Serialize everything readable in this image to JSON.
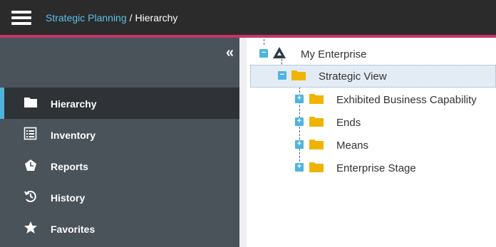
{
  "header": {
    "menu_icon": "hamburger-icon",
    "breadcrumb": {
      "parent": "Strategic Planning",
      "separator": "/",
      "current": "Hierarchy"
    },
    "colors": {
      "bar": "#2b2b2b",
      "accent": "#c8336b",
      "link": "#5bc0eb"
    }
  },
  "sidebar": {
    "collapse_icon": "double-chevron-left-icon",
    "items": [
      {
        "label": "Hierarchy",
        "icon": "folder-icon",
        "active": true
      },
      {
        "label": "Inventory",
        "icon": "list-icon",
        "active": false
      },
      {
        "label": "Reports",
        "icon": "pie-chart-icon",
        "active": false
      },
      {
        "label": "History",
        "icon": "history-icon",
        "active": false
      },
      {
        "label": "Favorites",
        "icon": "star-icon",
        "active": false
      }
    ],
    "colors": {
      "background": "#4a525a",
      "active_background": "#2f3236",
      "active_marker": "#4fb3e0"
    }
  },
  "tree": {
    "root": {
      "label": "My Enterprise",
      "icon": "enterprise-icon",
      "expanded": true
    },
    "selected": {
      "label": "Strategic View",
      "icon": "folder-icon",
      "expanded": true
    },
    "children": [
      {
        "label": "Exhibited Business Capability",
        "icon": "folder-icon",
        "expanded": false
      },
      {
        "label": "Ends",
        "icon": "folder-icon",
        "expanded": false
      },
      {
        "label": "Means",
        "icon": "folder-icon",
        "expanded": false
      },
      {
        "label": "Enterprise Stage",
        "icon": "folder-icon",
        "expanded": false
      }
    ],
    "colors": {
      "toggle": "#4fb3e0",
      "folder": "#f0b400",
      "selected_background": "#e3ecf5"
    }
  }
}
